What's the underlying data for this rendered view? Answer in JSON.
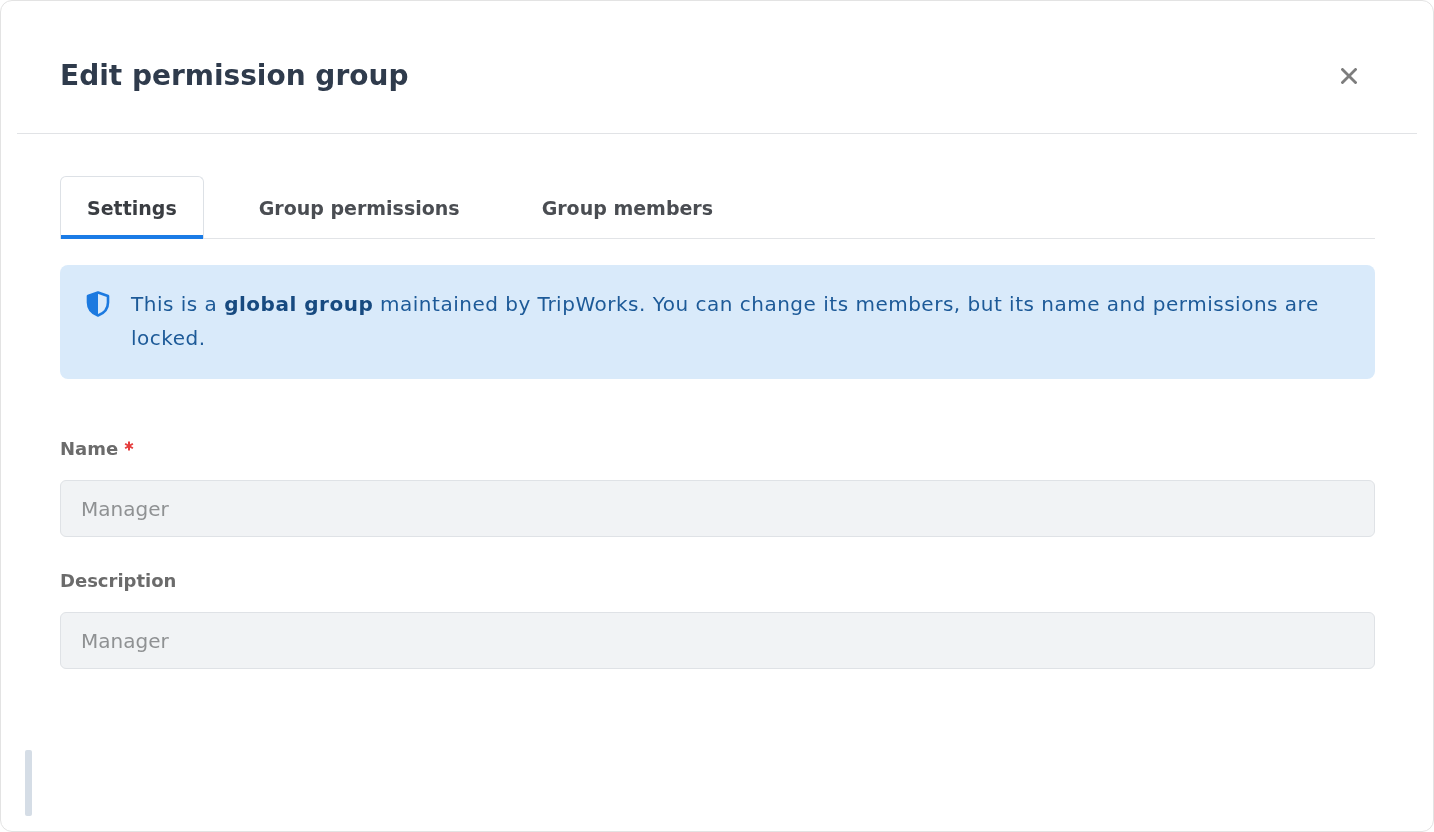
{
  "dialog": {
    "title": "Edit permission group"
  },
  "tabs": [
    {
      "label": "Settings",
      "selected": true
    },
    {
      "label": "Group permissions",
      "selected": false
    },
    {
      "label": "Group members",
      "selected": false
    }
  ],
  "notice": {
    "kind": "info",
    "text": "This is a **global group** maintained by TripWorks. You can change its members, but its name and permissions are locked."
  },
  "fields": [
    {
      "label": "Name",
      "required": true,
      "value": "Manager",
      "disabled": true
    },
    {
      "label": "Description",
      "required": false,
      "value": "Manager",
      "disabled": true
    }
  ]
}
